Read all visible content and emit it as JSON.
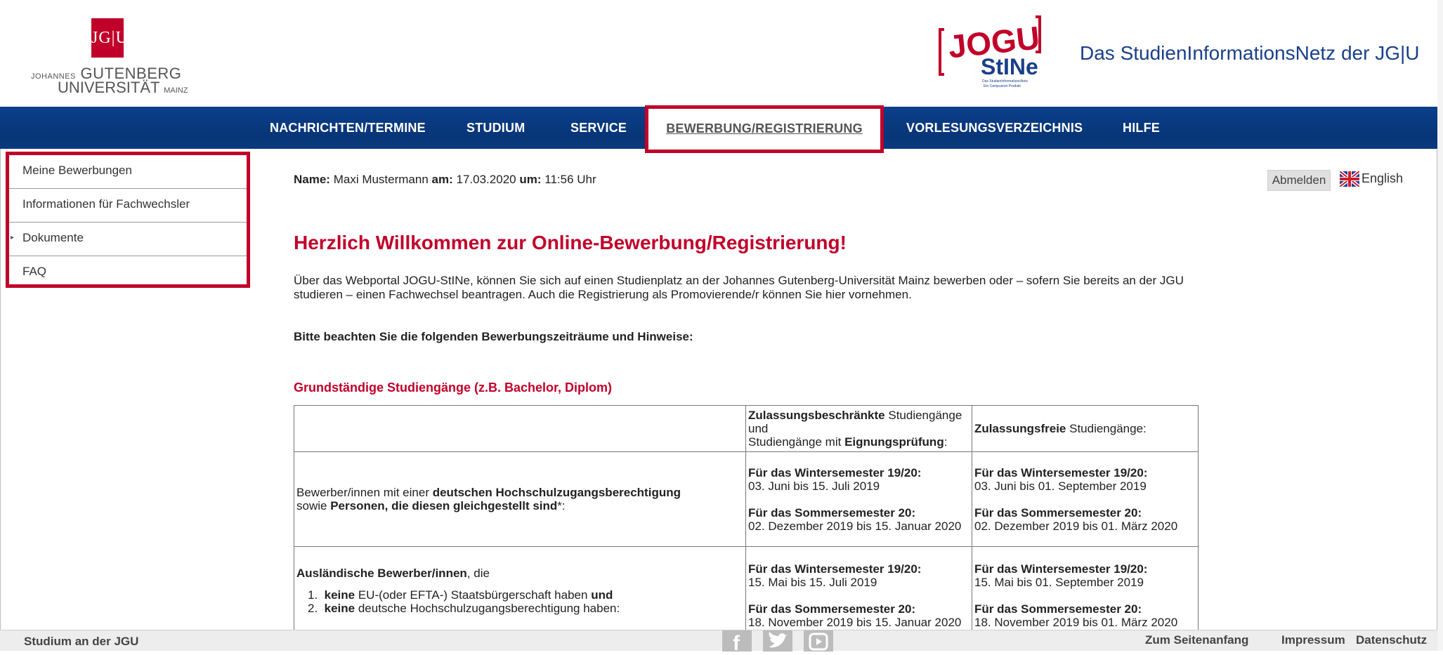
{
  "header": {
    "jgu_logo": {
      "box_text": "JG|U",
      "line1_small": "JOHANNES",
      "line1": "GUTENBERG",
      "line2": "UNIVERSITÄT",
      "line2_small": "MAINZ"
    },
    "stine_logo": {
      "top": "JOGU",
      "bottom": "StINe",
      "tagline1": "Das StudienInformationsNetz",
      "tagline2": "Ein Campusnet Produkt"
    },
    "site_title": "Das StudienInformationsNetz der JG|U"
  },
  "nav": {
    "items": [
      "NACHRICHTEN/TERMINE",
      "STUDIUM",
      "SERVICE",
      "BEWERBUNG/REGISTRIERUNG",
      "VORLESUNGSVERZEICHNIS",
      "HILFE"
    ],
    "active": "BEWERBUNG/REGISTRIERUNG"
  },
  "sidebar": {
    "items": [
      {
        "label": "Meine Bewerbungen"
      },
      {
        "label": "Informationen für Fachwechsler"
      },
      {
        "label": "Dokumente"
      },
      {
        "label": "FAQ"
      }
    ]
  },
  "user": {
    "name_label": "Name:",
    "name": "Maxi Mustermann",
    "date_label": "am:",
    "date": "17.03.2020",
    "time_label": "um:",
    "time": "11:56 Uhr",
    "logout_label": "Abmelden",
    "language_label": "English"
  },
  "main": {
    "title": "Herzlich Willkommen zur Online-Bewerbung/Registrierung!",
    "intro": "Über das Webportal JOGU-StINe, können Sie sich auf einen Studienplatz an der Johannes Gutenberg-Universität Mainz bewerben oder – sofern Sie bereits an der JGU studieren – einen Fachwechsel beantragen. Auch die Registrierung als Promovierende/r können Sie hier vornehmen.",
    "notice": "Bitte beachten Sie die folgenden Bewerbungszeiträume und Hinweise:",
    "section_title": "Grundständige Studiengänge (z.B. Bachelor, Diplom)",
    "table": {
      "header_col2_bold": "Zulassungsbeschränkte",
      "header_col2_rest1": "Studiengänge",
      "header_col2_and": "und",
      "header_col2_rest2": "Studiengänge mit",
      "header_col2_bold2": "Eignungsprüfung",
      "header_col2_colon": ":",
      "header_col3_bold": "Zulassungsfreie",
      "header_col3_rest": "Studiengänge:",
      "row1": {
        "pre": "Bewerber/innen mit einer",
        "bold1": "deutschen Hochschulzugangsberechtigung",
        "mid": "sowie",
        "bold2": "Personen, die diesen gleichgestellt sind",
        "post": "*:",
        "col2_ws_label": "Für das Wintersemester 19/20:",
        "col2_ws": "03. Juni bis 15. Juli 2019",
        "col2_ss_label": "Für das Sommersemester 20:",
        "col2_ss": "02. Dezember 2019 bis 15. Januar 2020",
        "col3_ws_label": "Für das Wintersemester 19/20:",
        "col3_ws": "03. Juni bis 01. September 2019",
        "col3_ss_label": "Für das Sommersemester 20:",
        "col3_ss": "02. Dezember 2019 bis 01. März 2020"
      },
      "row2": {
        "bold1": "Ausländische Bewerber/innen",
        "post": ", die",
        "li1_bold": "keine",
        "li1_rest": "EU-(oder EFTA-) Staatsbürgerschaft haben",
        "li1_and": "und",
        "li2_bold": "keine",
        "li2_rest": "deutsche Hochschulzugangsberechtigung haben:",
        "col2_ws_label": "Für das Wintersemester 19/20:",
        "col2_ws": "15. Mai bis 15. Juli 2019",
        "col2_ss_label": "Für das Sommersemester 20:",
        "col2_ss": "18. November 2019 bis 15. Januar 2020",
        "col3_ws_label": "Für das Wintersemester 19/20:",
        "col3_ws": "15. Mai bis 01. September 2019",
        "col3_ss_label": "Für das Sommersemester 20:",
        "col3_ss": "18. November 2019 bis 01. März 2020"
      }
    }
  },
  "footer": {
    "left": "Studium an der JGU",
    "links": [
      "Zum Seitenanfang",
      "Impressum",
      "Datenschutz"
    ],
    "social_icons": [
      "facebook-icon",
      "twitter-icon",
      "youtube-icon"
    ]
  },
  "colors": {
    "accent": "#c1002a",
    "nav_bg": "#0a3a80",
    "title_blue": "#1a3f8a"
  }
}
